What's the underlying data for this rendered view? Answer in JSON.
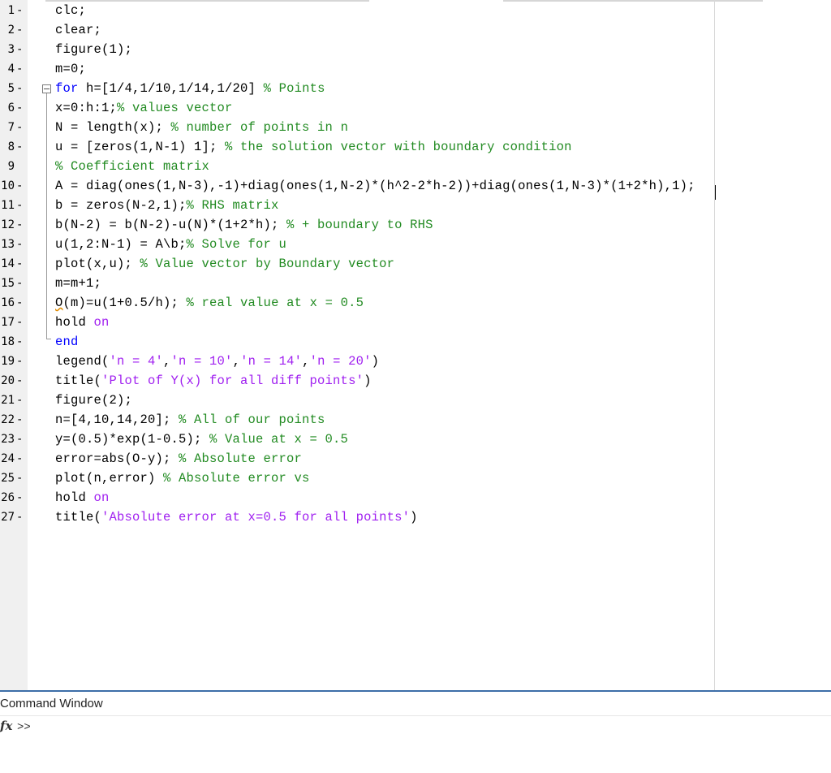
{
  "editor": {
    "lines": [
      {
        "n": "1",
        "dash": "-",
        "tokens": [
          {
            "t": "clc;",
            "c": ""
          }
        ]
      },
      {
        "n": "2",
        "dash": "-",
        "tokens": [
          {
            "t": "clear;",
            "c": ""
          }
        ]
      },
      {
        "n": "3",
        "dash": "-",
        "tokens": [
          {
            "t": "figure(1);",
            "c": ""
          }
        ]
      },
      {
        "n": "4",
        "dash": "-",
        "tokens": [
          {
            "t": "m=0;",
            "c": ""
          }
        ]
      },
      {
        "n": "5",
        "dash": "-",
        "tokens": [
          {
            "t": "for",
            "c": "kw"
          },
          {
            "t": " h=[1/4,1/10,1/14,1/20] ",
            "c": ""
          },
          {
            "t": "% Points",
            "c": "cm"
          }
        ]
      },
      {
        "n": "6",
        "dash": "-",
        "tokens": [
          {
            "t": "x=0:h:1;",
            "c": ""
          },
          {
            "t": "% values vector",
            "c": "cm"
          }
        ]
      },
      {
        "n": "7",
        "dash": "-",
        "tokens": [
          {
            "t": "N = length(x); ",
            "c": ""
          },
          {
            "t": "% number of points in n",
            "c": "cm"
          }
        ]
      },
      {
        "n": "8",
        "dash": "-",
        "tokens": [
          {
            "t": "u = [zeros(1,N-1) 1]; ",
            "c": ""
          },
          {
            "t": "% the solution vector with boundary condition",
            "c": "cm"
          }
        ]
      },
      {
        "n": "9",
        "dash": "",
        "tokens": [
          {
            "t": "% Coefficient matrix",
            "c": "cm"
          }
        ]
      },
      {
        "n": "10",
        "dash": "-",
        "tokens": [
          {
            "t": "A = diag(ones(1,N-3),-1)+diag(ones(1,N-2)*(h^2-2*h-2))+diag(ones(1,N-3)*(1+2*h),1);",
            "c": ""
          }
        ]
      },
      {
        "n": "11",
        "dash": "-",
        "tokens": [
          {
            "t": "b = zeros(N-2,1);",
            "c": ""
          },
          {
            "t": "% RHS matrix",
            "c": "cm"
          }
        ]
      },
      {
        "n": "12",
        "dash": "-",
        "tokens": [
          {
            "t": "b(N-2) = b(N-2)-u(N)*(1+2*h); ",
            "c": ""
          },
          {
            "t": "% + boundary to RHS",
            "c": "cm"
          }
        ]
      },
      {
        "n": "13",
        "dash": "-",
        "tokens": [
          {
            "t": "u(1,2:N-1) = A\\b;",
            "c": ""
          },
          {
            "t": "% Solve for u",
            "c": "cm"
          }
        ]
      },
      {
        "n": "14",
        "dash": "-",
        "tokens": [
          {
            "t": "plot(x,u); ",
            "c": ""
          },
          {
            "t": "% Value vector by Boundary vector",
            "c": "cm"
          }
        ]
      },
      {
        "n": "15",
        "dash": "-",
        "tokens": [
          {
            "t": "m=m+1;",
            "c": ""
          }
        ]
      },
      {
        "n": "16",
        "dash": "-",
        "tokens": [
          {
            "t": "O",
            "c": "uw"
          },
          {
            "t": "(m)=u(1+0.5/h); ",
            "c": ""
          },
          {
            "t": "% real value at x = 0.5",
            "c": "cm"
          }
        ]
      },
      {
        "n": "17",
        "dash": "-",
        "tokens": [
          {
            "t": "hold ",
            "c": ""
          },
          {
            "t": "on",
            "c": "st"
          }
        ]
      },
      {
        "n": "18",
        "dash": "-",
        "tokens": [
          {
            "t": "end",
            "c": "kw"
          }
        ]
      },
      {
        "n": "19",
        "dash": "-",
        "tokens": [
          {
            "t": "legend(",
            "c": ""
          },
          {
            "t": "'n = 4'",
            "c": "st"
          },
          {
            "t": ",",
            "c": ""
          },
          {
            "t": "'n = 10'",
            "c": "st"
          },
          {
            "t": ",",
            "c": ""
          },
          {
            "t": "'n = 14'",
            "c": "st"
          },
          {
            "t": ",",
            "c": ""
          },
          {
            "t": "'n = 20'",
            "c": "st"
          },
          {
            "t": ")",
            "c": ""
          }
        ]
      },
      {
        "n": "20",
        "dash": "-",
        "tokens": [
          {
            "t": "title(",
            "c": ""
          },
          {
            "t": "'Plot of Y(x) for all diff points'",
            "c": "st"
          },
          {
            "t": ")",
            "c": ""
          }
        ]
      },
      {
        "n": "21",
        "dash": "-",
        "tokens": [
          {
            "t": "figure(2);",
            "c": ""
          }
        ]
      },
      {
        "n": "22",
        "dash": "-",
        "tokens": [
          {
            "t": "n=[4,10,14,20]; ",
            "c": ""
          },
          {
            "t": "% All of our points",
            "c": "cm"
          }
        ]
      },
      {
        "n": "23",
        "dash": "-",
        "tokens": [
          {
            "t": "y=(0.5)*exp(1-0.5); ",
            "c": ""
          },
          {
            "t": "% Value at x = 0.5",
            "c": "cm"
          }
        ]
      },
      {
        "n": "24",
        "dash": "-",
        "tokens": [
          {
            "t": "error=abs(O-y); ",
            "c": ""
          },
          {
            "t": "% Absolute error",
            "c": "cm"
          }
        ]
      },
      {
        "n": "25",
        "dash": "-",
        "tokens": [
          {
            "t": "plot(n,error) ",
            "c": ""
          },
          {
            "t": "% Absolute error vs",
            "c": "cm"
          }
        ]
      },
      {
        "n": "26",
        "dash": "-",
        "tokens": [
          {
            "t": "hold ",
            "c": ""
          },
          {
            "t": "on",
            "c": "st"
          }
        ]
      },
      {
        "n": "27",
        "dash": "-",
        "tokens": [
          {
            "t": "title(",
            "c": ""
          },
          {
            "t": "'Absolute error at x=0.5 for all points'",
            "c": "st"
          },
          {
            "t": ")",
            "c": ""
          }
        ]
      }
    ]
  },
  "command_window": {
    "title": "Command Window",
    "fx_label": "fx",
    "prompt": ">>"
  },
  "colors": {
    "keyword": "#0000ff",
    "comment": "#228b22",
    "string": "#a020f0",
    "separator": "#3c6ea8"
  }
}
